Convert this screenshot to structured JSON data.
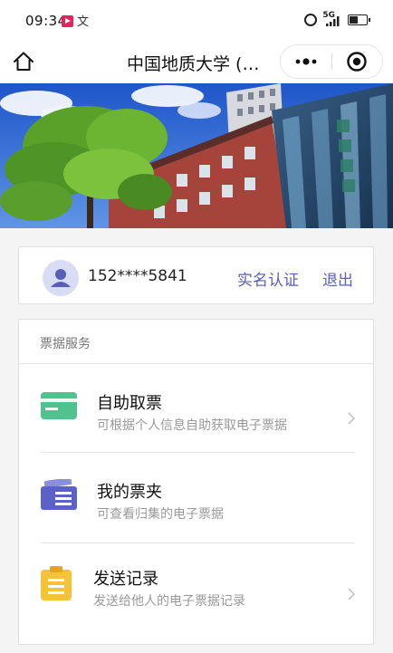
{
  "status_bar": {
    "time": "09:34",
    "extra_glyph": "文",
    "network": "5G"
  },
  "nav": {
    "title": "中国地质大学 (…",
    "icons": [
      "home-icon",
      "more-icon",
      "close-capsule-icon"
    ]
  },
  "hero": {
    "description_icons": [
      "campus-building-photo"
    ]
  },
  "user": {
    "phone": "152****5841",
    "verify_label": "实名认证",
    "logout_label": "退出"
  },
  "services": {
    "section_title": "票据服务",
    "items": [
      {
        "title": "自助取票",
        "desc": "可根据个人信息自助获取电子票据",
        "icon": "card-icon",
        "color": "#4fc28e"
      },
      {
        "title": "我的票夹",
        "desc": "可查看归集的电子票据",
        "icon": "ticket-folder-icon",
        "color": "#5b61c9"
      },
      {
        "title": "发送记录",
        "desc": "发送给他人的电子票据记录",
        "icon": "send-record-icon",
        "color": "#f7c238"
      }
    ]
  },
  "colors": {
    "link": "#5a5fb8",
    "text": "#222222",
    "muted": "#999999",
    "background": "#f4f4f4"
  }
}
